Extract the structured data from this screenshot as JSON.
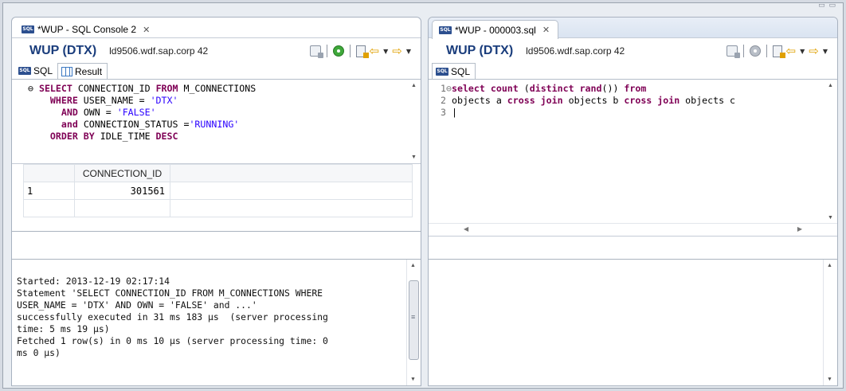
{
  "window": {
    "controls": "▭ ▭"
  },
  "left": {
    "tab_title": "*WUP - SQL Console 2",
    "tab_close": "✕",
    "conn_name": "WUP (DTX)",
    "conn_host": "ld9506.wdf.sap.corp 42",
    "subtabs": [
      {
        "label": "SQL"
      },
      {
        "label": "Result"
      }
    ],
    "sql_lines": [
      [
        "⊖ ",
        "SELECT",
        " CONNECTION_ID ",
        "FROM",
        " M_CONNECTIONS"
      ],
      [
        "    ",
        "WHERE",
        " USER_NAME = ",
        "'DTX'",
        ""
      ],
      [
        "      ",
        "AND",
        " OWN = ",
        "'FALSE'",
        ""
      ],
      [
        "      ",
        "and",
        " CONNECTION_STATUS =",
        "'RUNNING'",
        ""
      ],
      [
        "    ",
        "ORDER BY",
        " IDLE_TIME ",
        "DESC",
        ""
      ]
    ],
    "result_header": "CONNECTION_ID",
    "result_rows": [
      {
        "num": "1",
        "value": "301561"
      }
    ],
    "log_lines": [
      "Started: 2013-12-19 02:17:14",
      "Statement 'SELECT CONNECTION_ID FROM M_CONNECTIONS WHERE",
      "USER_NAME = 'DTX' AND OWN = 'FALSE' and ...'",
      "successfully executed in 31 ms 183 µs  (server processing",
      "time: 5 ms 19 µs)",
      "Fetched 1 row(s) in 0 ms 10 µs (server processing time: 0",
      "ms 0 µs)"
    ]
  },
  "right": {
    "tab_title": "*WUP - 000003.sql",
    "tab_close": "✕",
    "conn_name": "WUP (DTX)",
    "conn_host": "ld9506.wdf.sap.corp 42",
    "subtabs": [
      {
        "label": "SQL"
      }
    ],
    "code_lines": [
      {
        "num": "1",
        "fold": "⊖",
        "parts": [
          [
            "kw",
            "select"
          ],
          [
            "t",
            " "
          ],
          [
            "kw",
            "count"
          ],
          [
            "t",
            " ("
          ],
          [
            "kw",
            "distinct"
          ],
          [
            "t",
            " "
          ],
          [
            "kw",
            "rand"
          ],
          [
            "t",
            "()) "
          ],
          [
            "kw",
            "from"
          ]
        ]
      },
      {
        "num": "2",
        "fold": " ",
        "parts": [
          [
            "t",
            "objects a "
          ],
          [
            "kw",
            "cross join"
          ],
          [
            "t",
            " objects b "
          ],
          [
            "kw",
            "cross join"
          ],
          [
            "t",
            " objects c"
          ]
        ]
      },
      {
        "num": "3",
        "fold": " ",
        "parts": [
          [
            "t",
            "|"
          ]
        ]
      }
    ]
  },
  "icons": {
    "sql_badge": "SQL",
    "arrow_back": "⇦",
    "arrow_fwd": "⇨",
    "dropdown": "▼",
    "scroll_up": "▲",
    "scroll_down": "▼",
    "scroll_left": "◀",
    "scroll_right": "▶"
  }
}
